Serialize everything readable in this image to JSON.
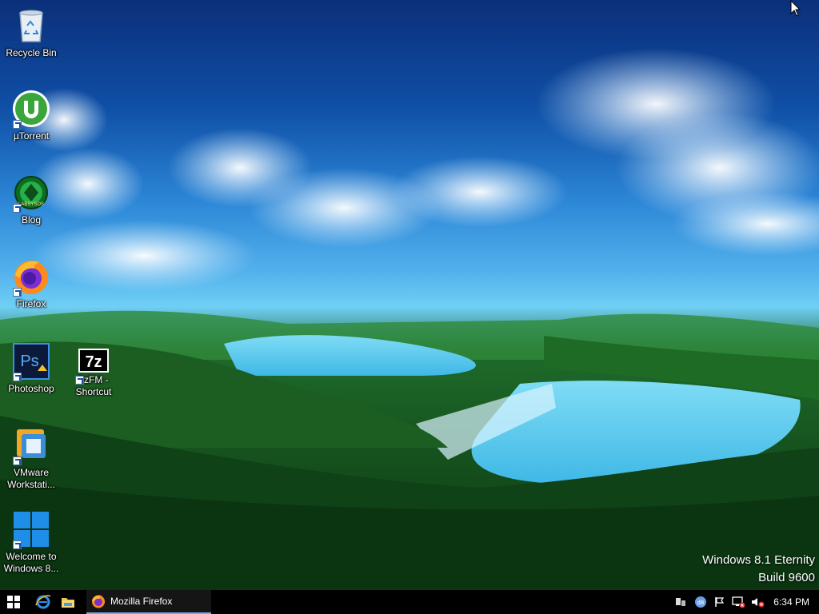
{
  "desktop": {
    "icons": [
      {
        "label": "Recycle Bin"
      },
      {
        "label": "µTorrent"
      },
      {
        "label": "Blog",
        "badge_text": "LABSYSOS"
      },
      {
        "label": "Firefox"
      },
      {
        "label": "Photoshop",
        "glyph": "Ps"
      },
      {
        "label": "7zFM - Shortcut",
        "glyph": "7z"
      },
      {
        "label": "VMware Workstati..."
      },
      {
        "label": "Welcome to Windows 8..."
      }
    ],
    "watermark": {
      "line1": "Windows 8.1 Eternity",
      "line2": "Build 9600"
    }
  },
  "taskbar": {
    "running_app": "Mozilla Firefox",
    "clock": "6:34 PM",
    "tray_badge": "dB"
  },
  "colors": {
    "taskbar_bg": "#000000",
    "active_underline": "#7aa9e8",
    "windows_blue": "#1e8ee8"
  },
  "icon_names": [
    "recycle-bin-icon",
    "utorrent-icon",
    "blog-icon",
    "firefox-icon",
    "photoshop-icon",
    "7zip-icon",
    "vmware-icon",
    "windows-logo-icon",
    "start-icon",
    "internet-explorer-icon",
    "file-explorer-icon",
    "network-icon",
    "flag-icon",
    "volume-muted-icon"
  ]
}
